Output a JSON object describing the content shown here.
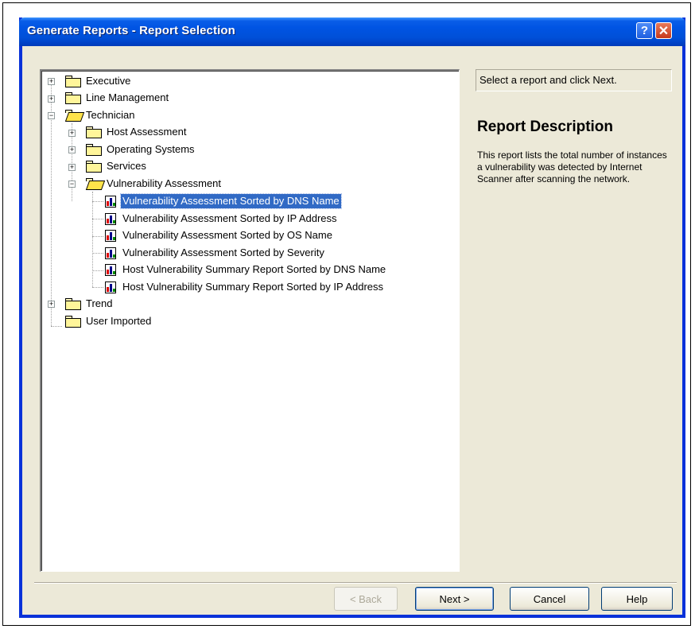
{
  "window": {
    "title": "Generate Reports - Report Selection",
    "help_glyph": "?",
    "close_glyph": "✕"
  },
  "tree": [
    {
      "label": "Executive",
      "expander": "+"
    },
    {
      "label": "Line Management",
      "expander": "+"
    },
    {
      "label": "Technician",
      "expander": "−"
    },
    {
      "label": "Host Assessment",
      "expander": "+"
    },
    {
      "label": "Operating Systems",
      "expander": "+"
    },
    {
      "label": "Services",
      "expander": "+"
    },
    {
      "label": "Vulnerability Assessment",
      "expander": "−"
    },
    {
      "label": "Vulnerability Assessment Sorted by DNS Name",
      "selected": true
    },
    {
      "label": "Vulnerability Assessment Sorted by IP Address"
    },
    {
      "label": "Vulnerability Assessment Sorted by OS Name"
    },
    {
      "label": "Vulnerability Assessment Sorted by Severity"
    },
    {
      "label": "Host Vulnerability Summary Report Sorted by DNS Name"
    },
    {
      "label": "Host Vulnerability Summary Report Sorted by IP Address"
    },
    {
      "label": "Trend",
      "expander": "+"
    },
    {
      "label": "User Imported"
    }
  ],
  "hint": "Select a report and click Next.",
  "description": {
    "title": "Report Description",
    "body": "This report lists the total number of instances a vulnerability was detected by Internet Scanner after scanning the network."
  },
  "buttons": {
    "back": "< Back",
    "next": "Next >",
    "cancel": "Cancel",
    "help": "Help"
  },
  "colors": {
    "titlebar": "#0054e3",
    "selection": "#316ac5",
    "dialog_bg": "#ece9d8"
  }
}
